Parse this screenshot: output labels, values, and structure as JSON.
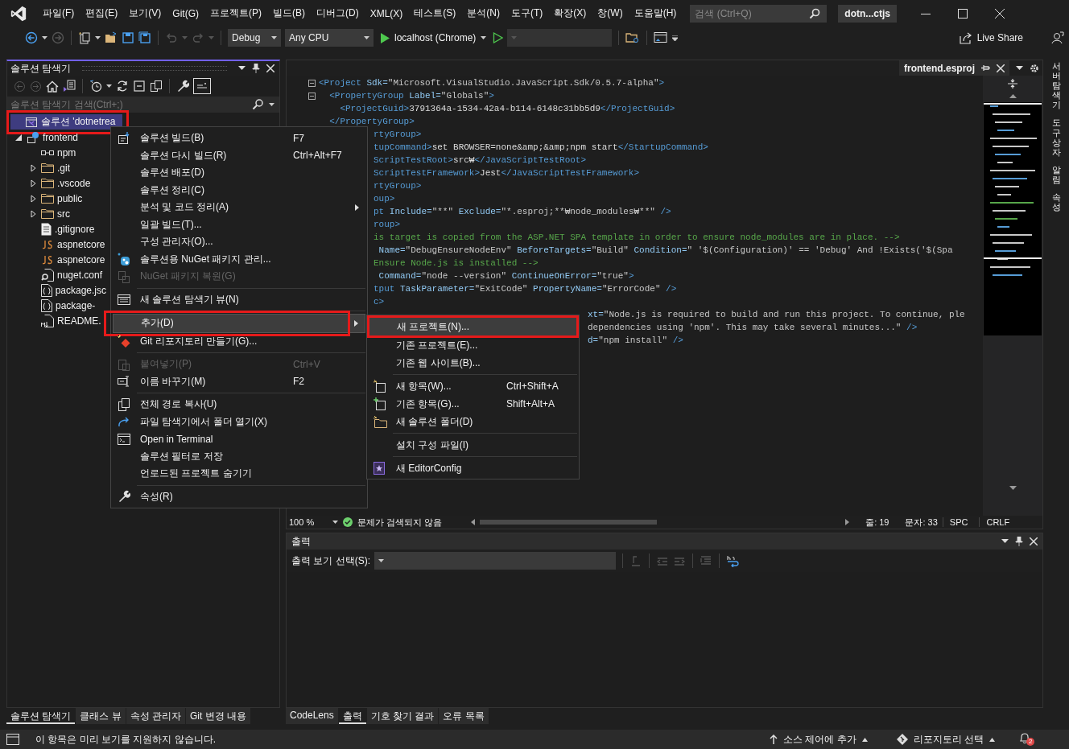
{
  "window": {
    "title": "dotn...ctjs"
  },
  "menu_bar": [
    "파일(F)",
    "편집(E)",
    "보기(V)",
    "Git(G)",
    "프로젝트(P)",
    "빌드(B)",
    "디버그(D)",
    "XML(X)",
    "테스트(S)",
    "분석(N)",
    "도구(T)",
    "확장(X)",
    "창(W)",
    "도움말(H)"
  ],
  "search": {
    "placeholder": "검색 (Ctrl+Q)"
  },
  "toolbar": {
    "configuration": "Debug",
    "platform": "Any CPU",
    "run_target": "localhost (Chrome)",
    "live_share": "Live Share"
  },
  "solution_explorer": {
    "title": "솔루션 탐색기",
    "search_placeholder": "솔루션 탐색기 검색(Ctrl+;)",
    "tree": [
      {
        "label": "솔루션 'dotnetrea",
        "kind": "solution",
        "selected": true,
        "marked": true,
        "children": [
          {
            "label": "frontend",
            "kind": "project",
            "selected": false,
            "expanded": true,
            "children": [
              {
                "label": "npm",
                "kind": "dependency",
                "selected": false
              },
              {
                "label": ".git",
                "kind": "folder",
                "selected": false,
                "expanded": false
              },
              {
                "label": ".vscode",
                "kind": "folder",
                "selected": false,
                "expanded": false
              },
              {
                "label": "public",
                "kind": "folder",
                "selected": false,
                "expanded": false
              },
              {
                "label": "src",
                "kind": "folder",
                "selected": false,
                "expanded": false
              },
              {
                "label": ".gitignore",
                "kind": "file",
                "selected": false
              },
              {
                "label": "aspnetcore",
                "kind": "js",
                "selected": false
              },
              {
                "label": "aspnetcore",
                "kind": "js",
                "selected": false
              },
              {
                "label": "nuget.conf",
                "kind": "config",
                "selected": false
              },
              {
                "label": "package.jsc",
                "kind": "json",
                "selected": false
              },
              {
                "label": "package-",
                "kind": "json",
                "selected": false
              },
              {
                "label": "README.",
                "kind": "markdown",
                "selected": false
              }
            ]
          }
        ]
      }
    ],
    "tabs": [
      {
        "label": "솔루션 탐색기",
        "selected": true
      },
      {
        "label": "클래스 뷰",
        "selected": false
      },
      {
        "label": "속성 관리자",
        "selected": false
      },
      {
        "label": "Git 변경 내용",
        "selected": false
      }
    ]
  },
  "editor": {
    "tab": "frontend.esproj",
    "lines": [
      {
        "kind": "full",
        "fold": true,
        "tokens": [
          {
            "kind": "tag",
            "text": "<Project"
          },
          {
            "kind": "attr",
            "text": " Sdk="
          },
          {
            "kind": "value",
            "text": "\"Microsoft.VisualStudio.JavaScript.Sdk/0.5.7-alpha\""
          },
          {
            "kind": "tag",
            "text": ">"
          }
        ]
      },
      {
        "kind": "full",
        "fold": true,
        "tokens": [
          {
            "kind": "tag",
            "text": "  <PropertyGroup"
          },
          {
            "kind": "attr",
            "text": " Label="
          },
          {
            "kind": "value",
            "text": "\"Globals\""
          },
          {
            "kind": "tag",
            "text": ">"
          }
        ]
      },
      {
        "kind": "full",
        "fold": false,
        "tokens": [
          {
            "kind": "tag",
            "text": "    <ProjectGuid>"
          },
          {
            "kind": "text",
            "text": "3791364a-1534-42a4-b114-6148c31bb5d9"
          },
          {
            "kind": "tag",
            "text": "</ProjectGuid>"
          }
        ]
      },
      {
        "kind": "full",
        "fold": false,
        "tokens": [
          {
            "kind": "tag",
            "text": "  </PropertyGroup>"
          }
        ]
      },
      {
        "kind": "menu",
        "fold": false,
        "tokens": [
          {
            "kind": "tag",
            "text": "rtyGroup>"
          }
        ]
      },
      {
        "kind": "menu",
        "fold": false,
        "tokens": [
          {
            "kind": "tag",
            "text": "tupCommand>"
          },
          {
            "kind": "text",
            "text": "set BROWSER=none&amp;&amp;npm start"
          },
          {
            "kind": "tag",
            "text": "</StartupCommand>"
          }
        ]
      },
      {
        "kind": "menu",
        "fold": false,
        "tokens": [
          {
            "kind": "tag",
            "text": "ScriptTestRoot>"
          },
          {
            "kind": "text",
            "text": "src₩"
          },
          {
            "kind": "tag",
            "text": "</JavaScriptTestRoot>"
          }
        ]
      },
      {
        "kind": "menu",
        "fold": false,
        "tokens": [
          {
            "kind": "tag",
            "text": "ScriptTestFramework>"
          },
          {
            "kind": "text",
            "text": "Jest"
          },
          {
            "kind": "tag",
            "text": "</JavaScriptTestFramework>"
          }
        ]
      },
      {
        "kind": "menu",
        "fold": false,
        "tokens": [
          {
            "kind": "tag",
            "text": "rtyGroup>"
          }
        ]
      },
      {
        "kind": "menu",
        "fold": false,
        "tokens": [
          {
            "kind": "tag",
            "text": "oup>"
          }
        ]
      },
      {
        "kind": "menu",
        "fold": false,
        "tokens": [
          {
            "kind": "tag",
            "text": "pt"
          },
          {
            "kind": "attr",
            "text": " Include="
          },
          {
            "kind": "value",
            "text": "\"**\""
          },
          {
            "kind": "attr",
            "text": " Exclude="
          },
          {
            "kind": "value",
            "text": "\"*.esproj;**₩node_modules₩**\""
          },
          {
            "kind": "tag",
            "text": " />"
          }
        ]
      },
      {
        "kind": "menu",
        "fold": false,
        "tokens": [
          {
            "kind": "tag",
            "text": "roup>"
          }
        ]
      },
      {
        "kind": "menu",
        "fold": false,
        "tokens": [
          {
            "kind": "comment",
            "text": "is target is copied from the ASP.NET SPA template in order to ensure node_modules are in place. -->"
          }
        ]
      },
      {
        "kind": "menu",
        "fold": false,
        "tokens": [
          {
            "kind": "attr",
            "text": " Name="
          },
          {
            "kind": "value",
            "text": "\"DebugEnsureNodeEnv\""
          },
          {
            "kind": "attr",
            "text": " BeforeTargets="
          },
          {
            "kind": "value",
            "text": "\"Build\""
          },
          {
            "kind": "attr",
            "text": " Condition="
          },
          {
            "kind": "value",
            "text": "\" '$(Configuration)' == 'Debug' And !Exists('$(Spa"
          }
        ]
      },
      {
        "kind": "menu",
        "fold": false,
        "tokens": [
          {
            "kind": "comment",
            "text": "Ensure Node.js is installed -->"
          }
        ]
      },
      {
        "kind": "menu",
        "fold": false,
        "tokens": [
          {
            "kind": "attr",
            "text": " Command="
          },
          {
            "kind": "value",
            "text": "\"node --version\""
          },
          {
            "kind": "attr",
            "text": " ContinueOnError="
          },
          {
            "kind": "value",
            "text": "\"true\""
          },
          {
            "kind": "tag",
            "text": ">"
          }
        ]
      },
      {
        "kind": "menu",
        "fold": false,
        "tokens": [
          {
            "kind": "tag",
            "text": "tput"
          },
          {
            "kind": "attr",
            "text": " TaskParameter="
          },
          {
            "kind": "value",
            "text": "\"ExitCode\""
          },
          {
            "kind": "attr",
            "text": " PropertyName="
          },
          {
            "kind": "value",
            "text": "\"ErrorCode\""
          },
          {
            "kind": "tag",
            "text": " />"
          }
        ]
      },
      {
        "kind": "menu",
        "fold": false,
        "tokens": [
          {
            "kind": "tag",
            "text": "c>"
          }
        ]
      },
      {
        "kind": "submenu",
        "fold": false,
        "tokens": [
          {
            "kind": "attr",
            "text": "xt="
          },
          {
            "kind": "value",
            "text": "\"Node.js is required to build and run this project. To continue, ple"
          }
        ]
      },
      {
        "kind": "submenu",
        "fold": false,
        "tokens": [
          {
            "kind": "value",
            "text": "dependencies using 'npm'. This may take several minutes...\""
          },
          {
            "kind": "tag",
            "text": " />"
          }
        ]
      },
      {
        "kind": "submenu",
        "fold": false,
        "tokens": [
          {
            "kind": "attr",
            "text": "d="
          },
          {
            "kind": "value",
            "text": "\"npm install\""
          },
          {
            "kind": "tag",
            "text": " />"
          }
        ]
      }
    ],
    "status": {
      "zoom": "100 %",
      "issues": "문제가 검색되지 않음",
      "line": "줄: 19",
      "column": "문자: 33",
      "whitespace": "SPC",
      "line_ending": "CRLF"
    }
  },
  "output": {
    "title": "출력",
    "source_label": "출력 보기 선택(S):",
    "tabs": [
      {
        "label": "CodeLens",
        "selected": false
      },
      {
        "label": "출력",
        "selected": true
      },
      {
        "label": "기호 찾기 결과",
        "selected": false
      },
      {
        "label": "오류 목록",
        "selected": false
      }
    ]
  },
  "side_tabs": [
    "서버 탐색기",
    "도구 상자",
    "알림",
    "속성"
  ],
  "context_menu": [
    {
      "kind": "item",
      "label": "솔루션 빌드(B)",
      "shortcut": "F7",
      "disabled": false,
      "submenu": false,
      "highlighted": false,
      "marked": false
    },
    {
      "kind": "item",
      "label": "솔루션 다시 빌드(R)",
      "shortcut": "Ctrl+Alt+F7",
      "disabled": false,
      "submenu": false,
      "highlighted": false,
      "marked": false
    },
    {
      "kind": "item",
      "label": "솔루션 배포(D)",
      "disabled": false,
      "submenu": false,
      "highlighted": false,
      "marked": false
    },
    {
      "kind": "item",
      "label": "솔루션 정리(C)",
      "disabled": false,
      "submenu": false,
      "highlighted": false,
      "marked": false
    },
    {
      "kind": "item",
      "label": "분석 및 코드 정리(A)",
      "disabled": false,
      "submenu": true,
      "highlighted": false,
      "marked": false
    },
    {
      "kind": "item",
      "label": "일괄 빌드(T)...",
      "disabled": false,
      "submenu": false,
      "highlighted": false,
      "marked": false
    },
    {
      "kind": "item",
      "label": "구성 관리자(O)...",
      "disabled": false,
      "submenu": false,
      "highlighted": false,
      "marked": false
    },
    {
      "kind": "item",
      "label": "솔루션용 NuGet 패키지 관리...",
      "disabled": false,
      "submenu": false,
      "highlighted": false,
      "marked": false
    },
    {
      "kind": "item",
      "label": "NuGet 패키지 복원(G)",
      "disabled": true,
      "submenu": false,
      "highlighted": false,
      "marked": false
    },
    {
      "kind": "separator"
    },
    {
      "kind": "item",
      "label": "새 솔루션 탐색기 뷰(N)",
      "disabled": false,
      "submenu": false,
      "highlighted": false,
      "marked": false
    },
    {
      "kind": "separator"
    },
    {
      "kind": "item",
      "label": "추가(D)",
      "disabled": false,
      "submenu": true,
      "highlighted": true,
      "marked": true
    },
    {
      "kind": "item",
      "label": "Git 리포지토리 만들기(G)...",
      "disabled": false,
      "submenu": false,
      "highlighted": false,
      "marked": false
    },
    {
      "kind": "separator"
    },
    {
      "kind": "item",
      "label": "붙여넣기(P)",
      "shortcut": "Ctrl+V",
      "disabled": true,
      "submenu": false,
      "highlighted": false,
      "marked": false
    },
    {
      "kind": "item",
      "label": "이름 바꾸기(M)",
      "shortcut": "F2",
      "disabled": false,
      "submenu": false,
      "highlighted": false,
      "marked": false
    },
    {
      "kind": "separator"
    },
    {
      "kind": "item",
      "label": "전체 경로 복사(U)",
      "disabled": false,
      "submenu": false,
      "highlighted": false,
      "marked": false
    },
    {
      "kind": "item",
      "label": "파일 탐색기에서 폴더 열기(X)",
      "disabled": false,
      "submenu": false,
      "highlighted": false,
      "marked": false
    },
    {
      "kind": "item",
      "label": "Open in Terminal",
      "disabled": false,
      "submenu": false,
      "highlighted": false,
      "marked": false
    },
    {
      "kind": "item",
      "label": "솔루션 필터로 저장",
      "disabled": false,
      "submenu": false,
      "highlighted": false,
      "marked": false
    },
    {
      "kind": "item",
      "label": "언로드된 프로젝트 숨기기",
      "disabled": false,
      "submenu": false,
      "highlighted": false,
      "marked": false
    },
    {
      "kind": "separator"
    },
    {
      "kind": "item",
      "label": "속성(R)",
      "disabled": false,
      "submenu": false,
      "highlighted": false,
      "marked": false
    }
  ],
  "add_submenu": [
    {
      "kind": "item",
      "label": "새 프로젝트(N)...",
      "highlighted": true,
      "marked": true
    },
    {
      "kind": "item",
      "label": "기존 프로젝트(E)...",
      "highlighted": false,
      "marked": false
    },
    {
      "kind": "item",
      "label": "기존 웹 사이트(B)...",
      "highlighted": false,
      "marked": false
    },
    {
      "kind": "separator"
    },
    {
      "kind": "item",
      "label": "새 항목(W)...",
      "shortcut": "Ctrl+Shift+A",
      "highlighted": false,
      "marked": false
    },
    {
      "kind": "item",
      "label": "기존 항목(G)...",
      "shortcut": "Shift+Alt+A",
      "highlighted": false,
      "marked": false
    },
    {
      "kind": "item",
      "label": "새 솔루션 폴더(D)",
      "highlighted": false,
      "marked": false
    },
    {
      "kind": "separator"
    },
    {
      "kind": "item",
      "label": "설치 구성 파일(I)",
      "highlighted": false,
      "marked": false
    },
    {
      "kind": "separator"
    },
    {
      "kind": "item",
      "label": "새 EditorConfig",
      "highlighted": false,
      "marked": false
    }
  ],
  "status_bar": {
    "message": "이 항목은 미리 보기를 지원하지 않습니다.",
    "source_control": "소스 제어에 추가",
    "repository": "리포지토리 선택",
    "notifications": "2"
  }
}
